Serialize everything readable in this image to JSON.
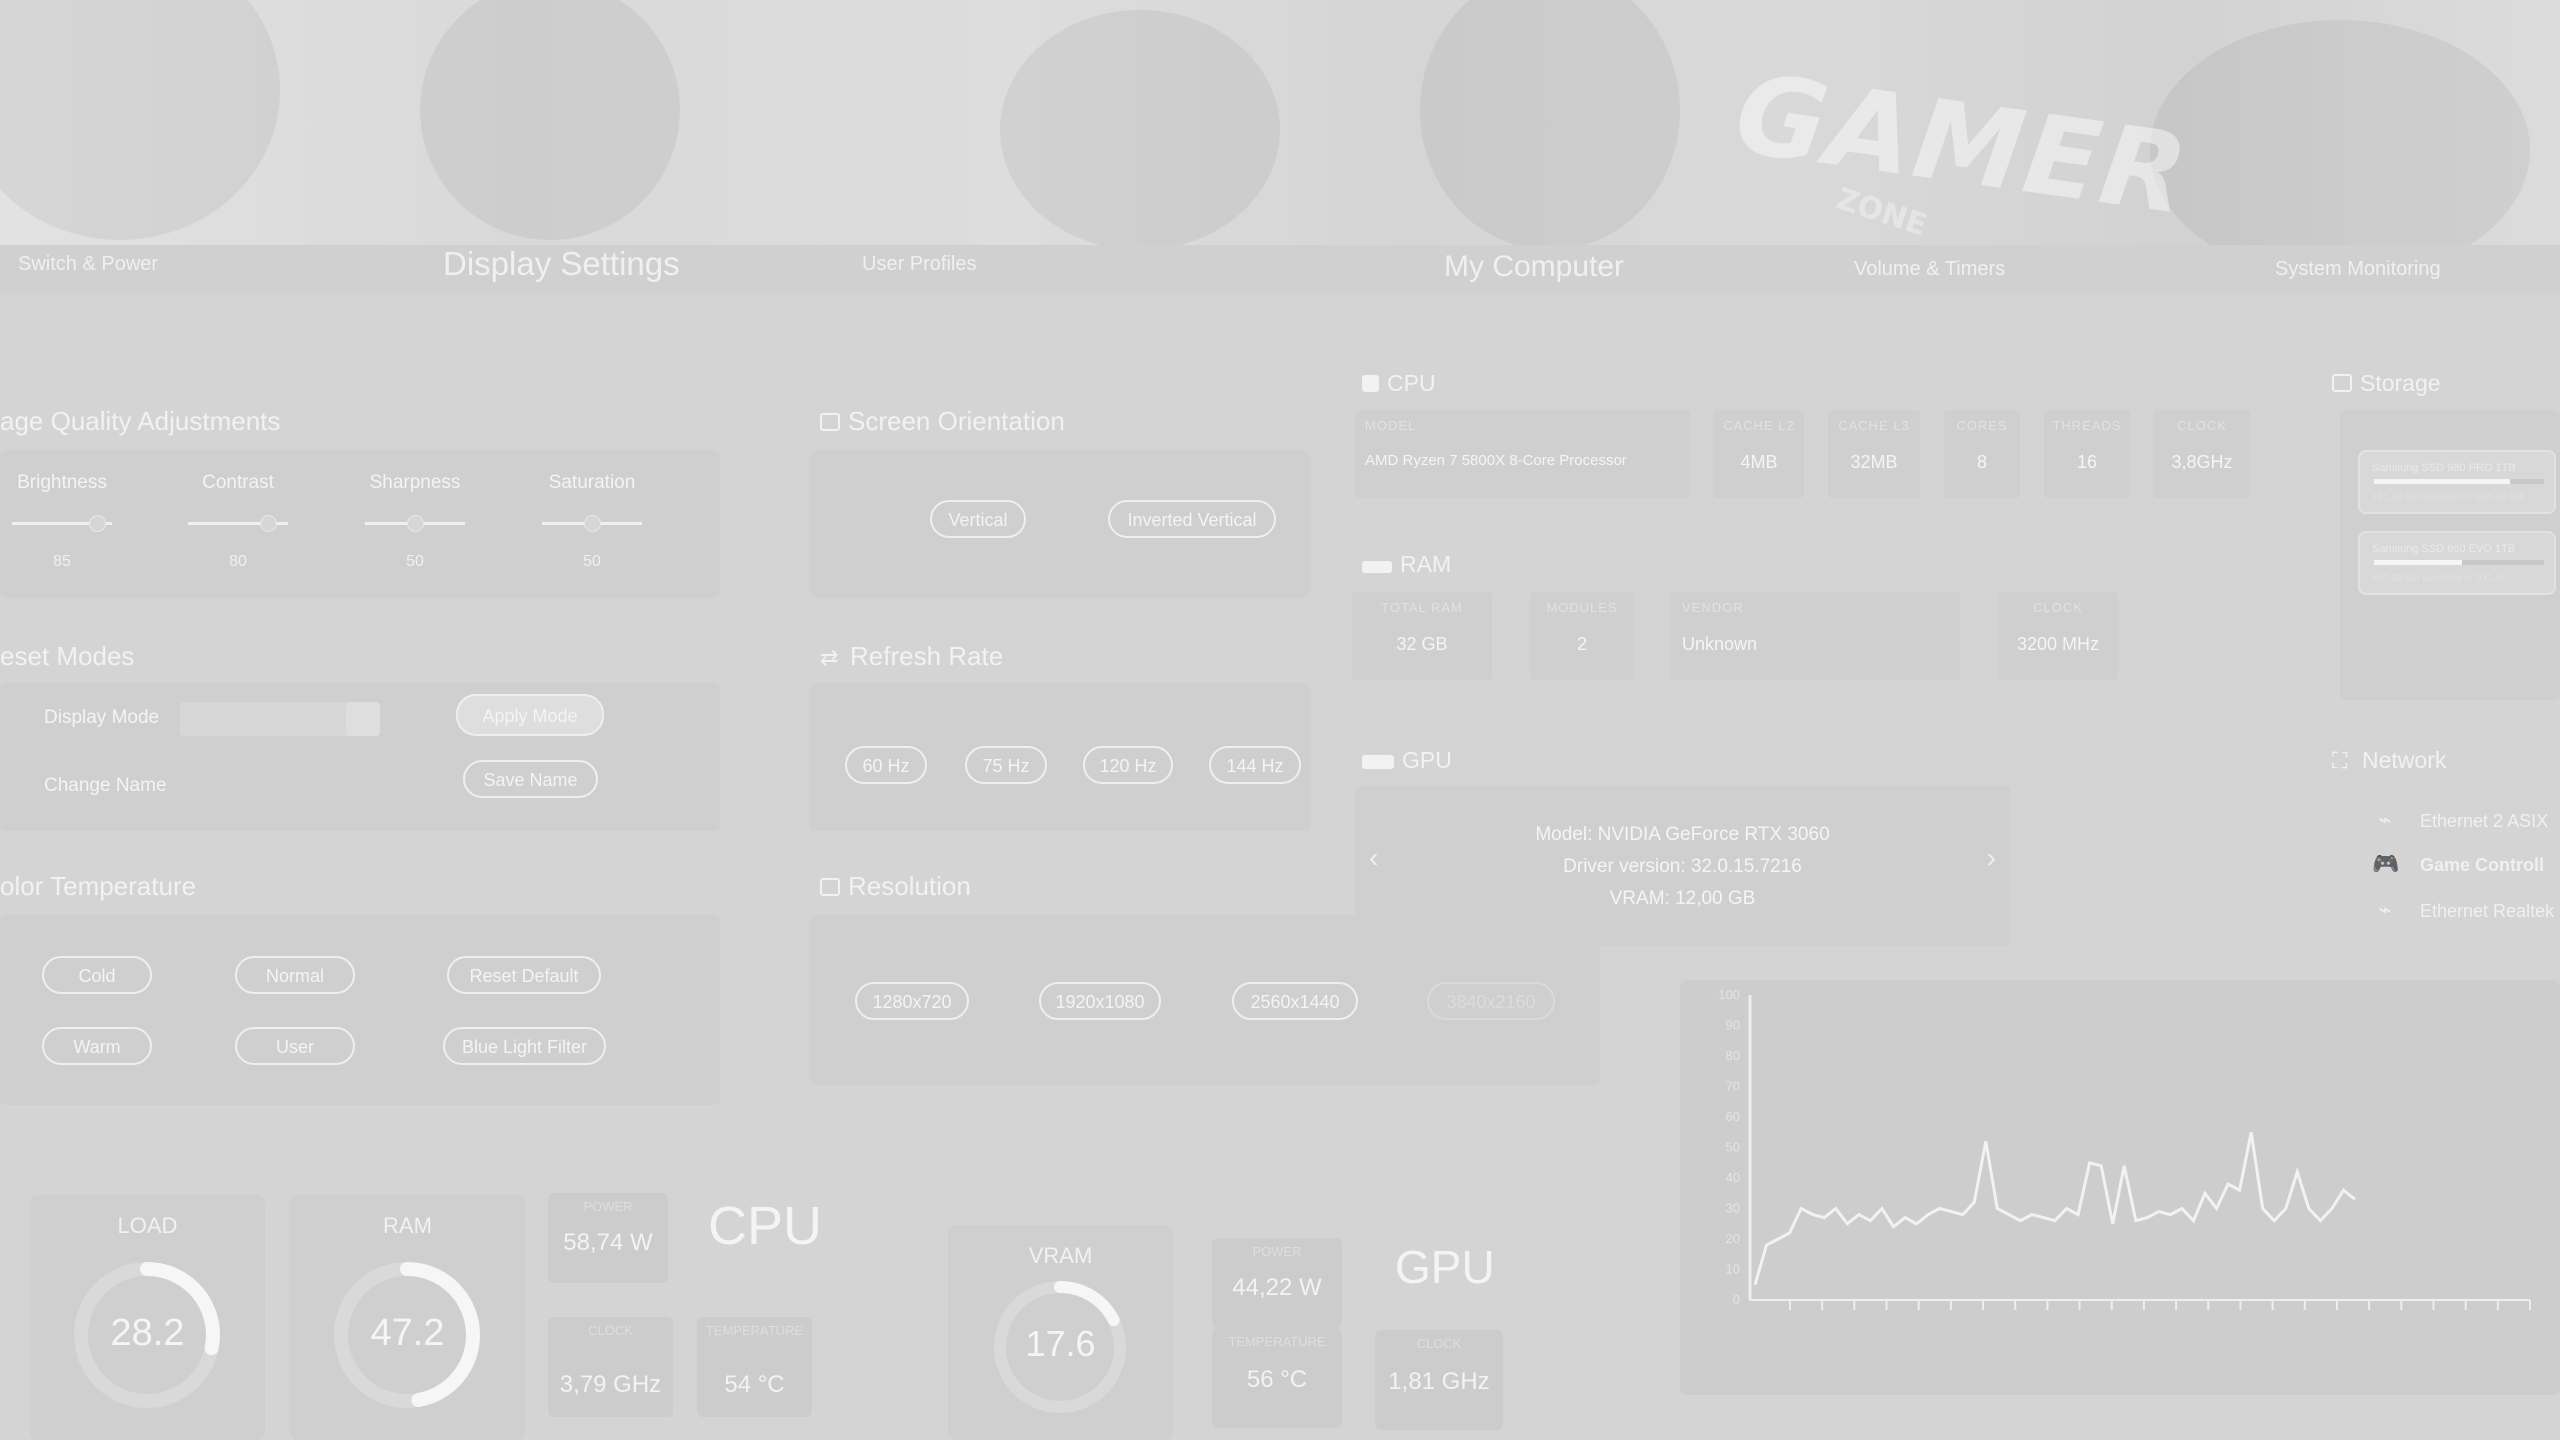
{
  "banner": {
    "logo_text": "GAMER",
    "logo_sub": "ZONE"
  },
  "tabs": {
    "switch_power": "Switch & Power",
    "display_settings": "Display Settings",
    "user_profiles": "User Profiles",
    "my_computer": "My Computer",
    "volume_timers": "Volume & Timers",
    "system_monitoring": "System Monitoring"
  },
  "image_quality": {
    "title": "age Quality Adjustments",
    "sliders": [
      {
        "label": "Brightness",
        "value": "85",
        "level": 0.85
      },
      {
        "label": "Contrast",
        "value": "80",
        "level": 0.8
      },
      {
        "label": "Sharpness",
        "value": "50",
        "level": 0.5
      },
      {
        "label": "Saturation",
        "value": "50",
        "level": 0.5
      }
    ]
  },
  "preset_modes": {
    "title": "eset Modes",
    "display_mode_label": "Display Mode",
    "apply_button": "Apply Mode",
    "change_name_label": "Change Name",
    "save_button": "Save Name"
  },
  "color_temperature": {
    "title": "olor Temperature",
    "buttons": [
      "Cold",
      "Normal",
      "Reset Default",
      "Warm",
      "User",
      "Blue Light Filter"
    ]
  },
  "screen_orientation": {
    "title": "Screen Orientation",
    "buttons": [
      "Vertical",
      "Inverted Vertical"
    ]
  },
  "refresh_rate": {
    "title": "Refresh Rate",
    "buttons": [
      "60 Hz",
      "75 Hz",
      "120 Hz",
      "144 Hz"
    ]
  },
  "resolution": {
    "title": "Resolution",
    "buttons": [
      "1280x720",
      "1920x1080",
      "2560x1440",
      "3840x2160"
    ]
  },
  "cpu_info": {
    "title": "CPU",
    "model_header": "MODEL",
    "model": "AMD Ryzen 7 5800X 8-Core Processor",
    "cache_l2_header": "CACHE L2",
    "cache_l2": "4MB",
    "cache_l3_header": "CACHE L3",
    "cache_l3": "32MB",
    "cores_header": "CORES",
    "cores": "8",
    "threads_header": "THREADS",
    "threads": "16",
    "clock_header": "CLOCK",
    "clock": "3,8GHz"
  },
  "ram_info": {
    "title": "RAM",
    "total_header": "TOTAL RAM",
    "total": "32 GB",
    "modules_header": "MODULES",
    "modules": "2",
    "vendor_header": "VENDOR",
    "vendor": "Unknown",
    "clock_header": "CLOCK",
    "clock": "3200 MHz"
  },
  "gpu_info": {
    "title": "GPU",
    "model": "Model: NVIDIA GeForce RTX 3060",
    "driver": "Driver version: 32.0.15.7216",
    "vram": "VRAM: 12,00 GB",
    "prev": "‹",
    "next": "›"
  },
  "storage": {
    "title": "Storage",
    "drives": [
      {
        "name": "Samsung SSD 980 PRO 1TB",
        "sub": "181,86 GB available of 930,86 GB",
        "level": 0.8
      },
      {
        "name": "Samsung SSD 860 EVO 1TB",
        "sub": "450,39 GB available of 931,51...",
        "level": 0.52
      }
    ]
  },
  "network": {
    "title": "Network",
    "items": [
      {
        "icon": "ethernet-icon",
        "label": "Ethernet 2 ASIX"
      },
      {
        "icon": "gamepad-icon",
        "label": "Game Controll"
      },
      {
        "icon": "ethernet-icon",
        "label": "Ethernet Realtek"
      }
    ]
  },
  "monitor": {
    "cpu_label": "CPU",
    "gpu_label": "GPU",
    "load_title": "LOAD",
    "load_value": "28.2",
    "load_level": 0.282,
    "ram_title": "RAM",
    "ram_value": "47.2",
    "ram_level": 0.472,
    "vram_title": "VRAM",
    "vram_value": "17.6",
    "vram_level": 0.176,
    "cpu_power_header": "POWER",
    "cpu_power": "58,74 W",
    "cpu_clock_header": "CLOCK",
    "cpu_clock": "3,79 GHz",
    "cpu_temp_header": "TEMPERATURE",
    "cpu_temp": "54 °C",
    "gpu_power_header": "POWER",
    "gpu_power": "44,22 W",
    "gpu_temp_header": "TEMPERATURE",
    "gpu_temp": "56 °C",
    "gpu_clock_header": "CLOCK",
    "gpu_clock": "1,81 GHz"
  },
  "chart_data": {
    "type": "line",
    "title": "",
    "xlabel": "",
    "ylabel": "",
    "ylim": [
      0,
      100
    ],
    "yticks": [
      "100",
      "90",
      "80",
      "70",
      "60",
      "50",
      "40",
      "30",
      "20",
      "10",
      "0"
    ],
    "series": [
      {
        "values": [
          5,
          18,
          20,
          22,
          30,
          28,
          27,
          30,
          25,
          28,
          26,
          30,
          24,
          27,
          25,
          28,
          30,
          29,
          28,
          32,
          52,
          30,
          28,
          26,
          28,
          27,
          26,
          30,
          28,
          45,
          44,
          25,
          44,
          26,
          27,
          29,
          28,
          30,
          26,
          35,
          30,
          38,
          36,
          55,
          30,
          26,
          30,
          42,
          30,
          26,
          30,
          36,
          33
        ]
      }
    ]
  },
  "colors": {
    "background": "#d4d4d4",
    "text": "#f0f0f0",
    "accent": "#ffffff"
  }
}
